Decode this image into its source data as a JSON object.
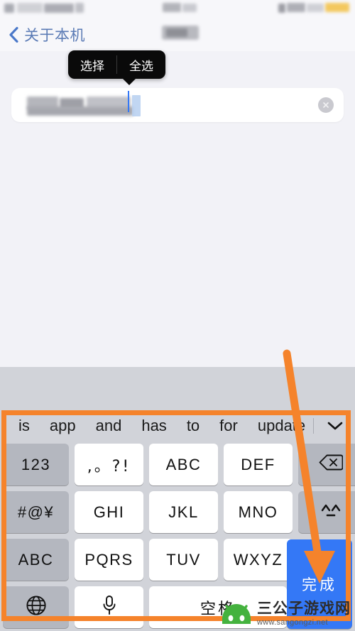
{
  "statusbar": {
    "redacted": true,
    "note": "status bar contents are mosaiced/blurred",
    "battery_color": "#f5c842"
  },
  "navbar": {
    "back_icon": "chevron-left-icon",
    "title": "关于本机",
    "title_color": "#5b7bb5",
    "redacted_badge": true
  },
  "context_menu": {
    "items": [
      {
        "label": "选择"
      },
      {
        "label": "全选"
      }
    ],
    "background": "#0a0a0a",
    "text_color": "#ffffff"
  },
  "text_field": {
    "value": "",
    "placeholder": "",
    "redacted": true,
    "has_selection": true,
    "clear_icon": "clear-circle-x-icon",
    "caret_color": "#3478f6",
    "selection_color": "#b6cff0",
    "background": "#ffffff"
  },
  "keyboard": {
    "background": "#d1d3d9",
    "prediction": {
      "words": [
        "is",
        "app",
        "and",
        "has",
        "to",
        "for",
        "update"
      ],
      "collapse_icon": "chevron-down-icon"
    },
    "rows": [
      [
        {
          "label": "123",
          "style": "dark",
          "name": "key-123"
        },
        {
          "label": ",。?!",
          "style": "light",
          "name": "key-punctuation"
        },
        {
          "label": "ABC",
          "style": "light",
          "name": "key-abc"
        },
        {
          "label": "DEF",
          "style": "light",
          "name": "key-def"
        },
        {
          "label": "",
          "style": "dark",
          "name": "key-backspace",
          "icon": "backspace-icon"
        }
      ],
      [
        {
          "label": "#@¥",
          "style": "dark",
          "name": "key-symbols"
        },
        {
          "label": "GHI",
          "style": "light",
          "name": "key-ghi"
        },
        {
          "label": "JKL",
          "style": "light",
          "name": "key-jkl"
        },
        {
          "label": "MNO",
          "style": "light",
          "name": "key-mno"
        },
        {
          "label": "^^",
          "style": "dark",
          "name": "key-emoticon"
        }
      ],
      [
        {
          "label": "ABC",
          "style": "dark",
          "name": "key-abc-mode"
        },
        {
          "label": "PQRS",
          "style": "light",
          "name": "key-pqrs"
        },
        {
          "label": "TUV",
          "style": "light",
          "name": "key-tuv"
        },
        {
          "label": "WXYZ",
          "style": "light",
          "name": "key-wxyz"
        }
      ],
      [
        {
          "label": "",
          "style": "dark",
          "name": "key-globe",
          "icon": "globe-icon"
        },
        {
          "label": "",
          "style": "light",
          "name": "key-dictation",
          "icon": "microphone-icon"
        },
        {
          "label": "空格",
          "style": "light",
          "name": "key-space"
        }
      ]
    ],
    "done_key": {
      "label": "完成",
      "color": "#3478f6",
      "text_color": "#ffffff",
      "name": "key-done"
    }
  },
  "annotations": {
    "highlight_color": "#f5832b",
    "rectangle": "keyboard-highlight-box",
    "arrow": "arrow-pointing-to-done-key"
  },
  "watermark": {
    "site_name": "三公子游戏网",
    "url": "www.sangongzi.net",
    "logo_color": "#44b23e"
  }
}
